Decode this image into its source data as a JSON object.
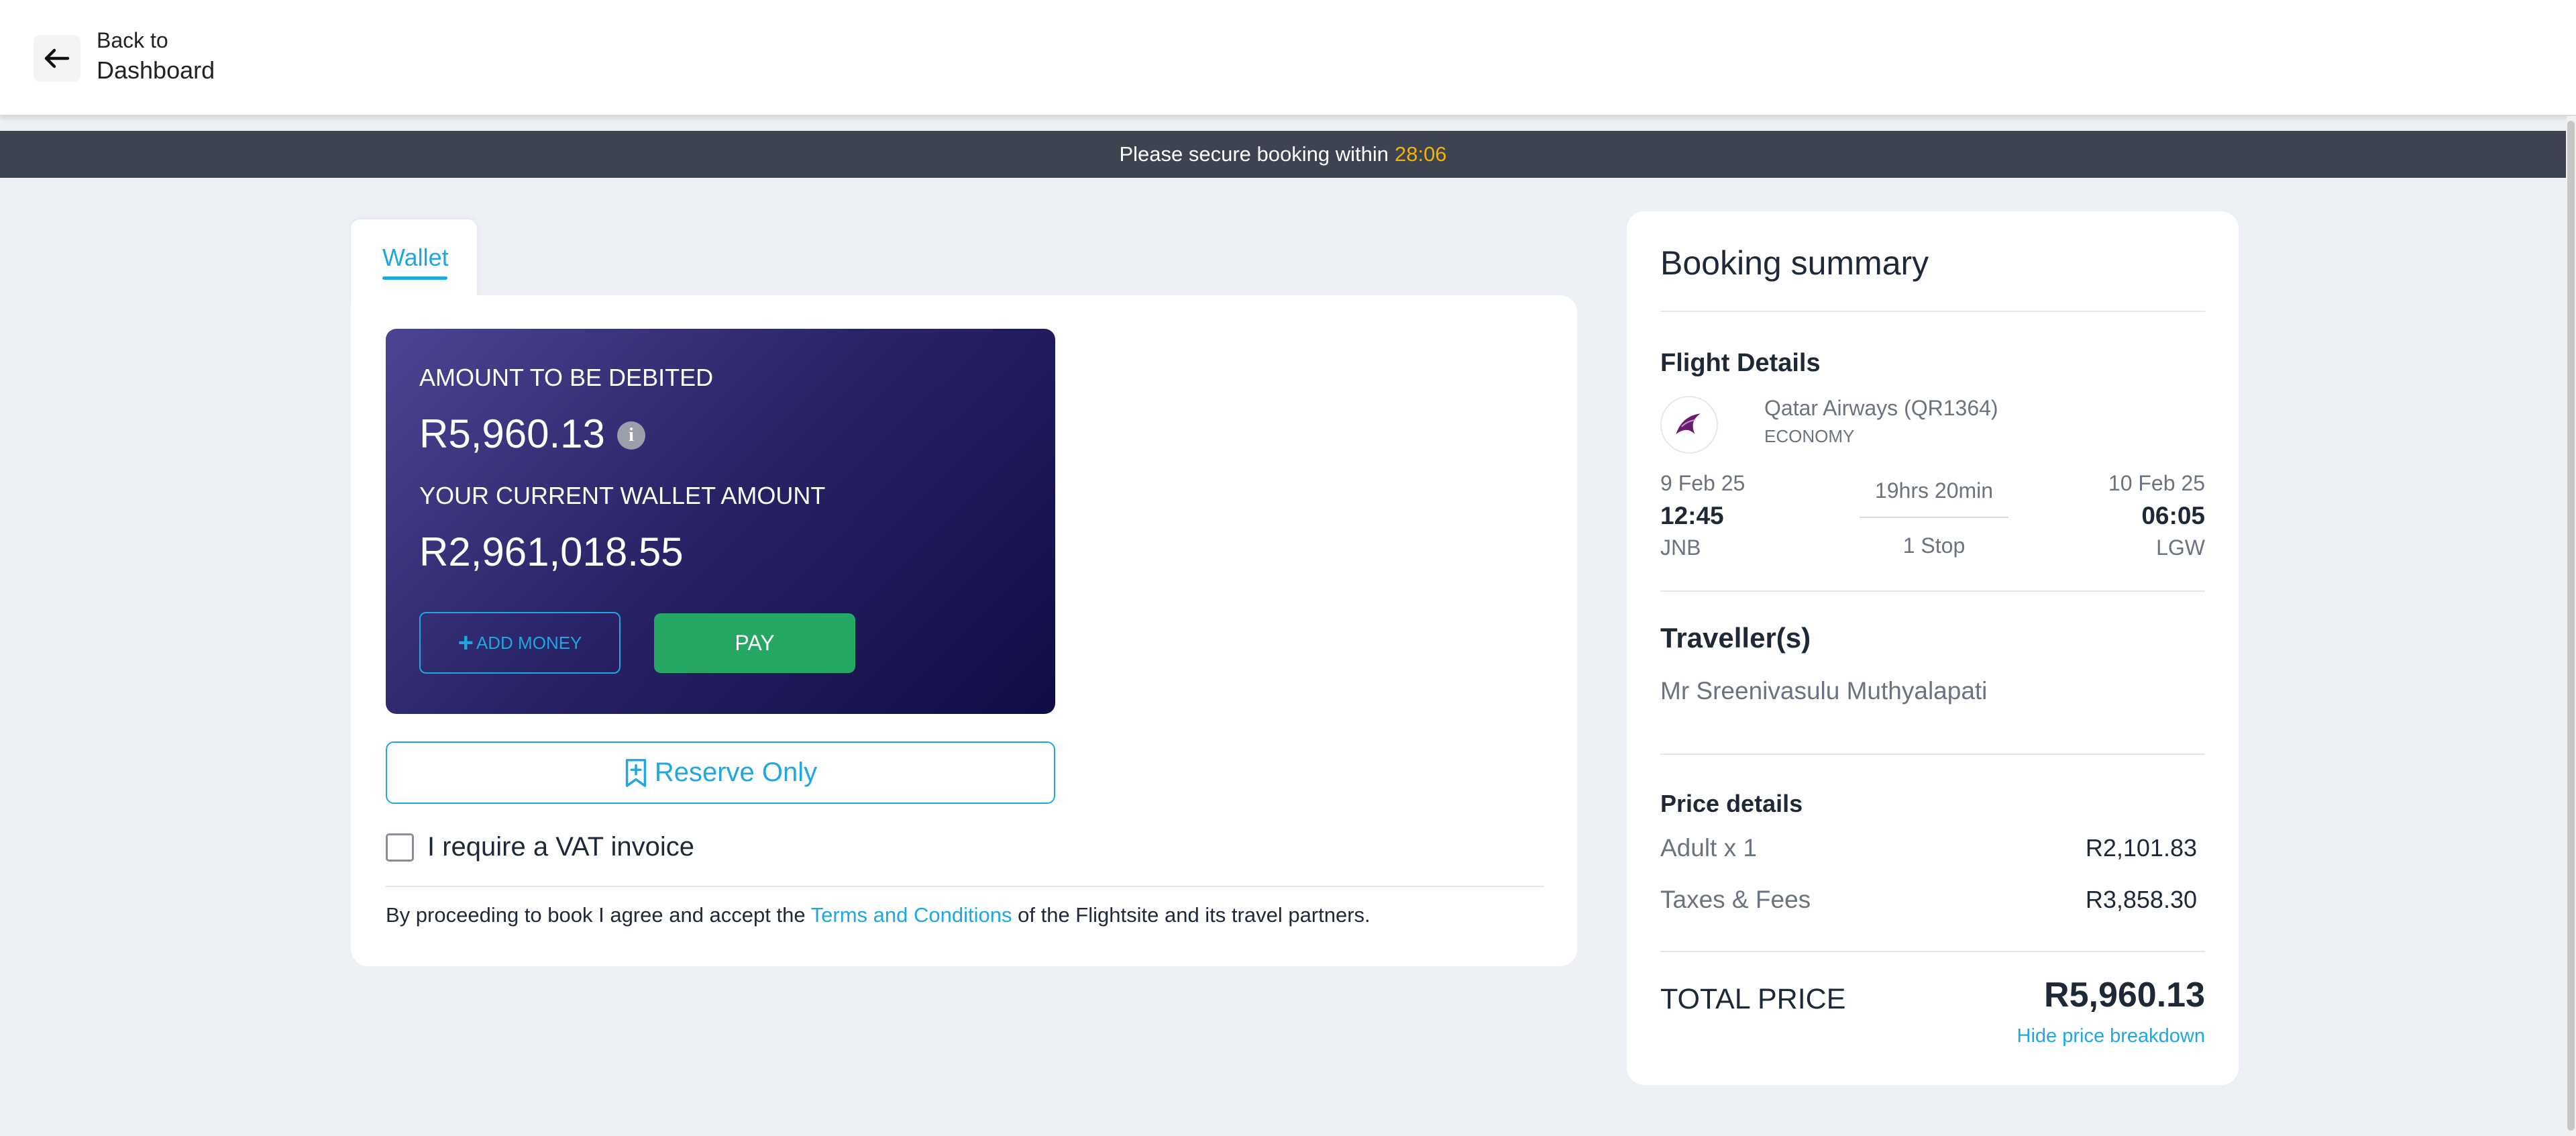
{
  "header": {
    "back_small": "Back to",
    "back_large": "Dashboard"
  },
  "timer": {
    "message": "Please secure booking within",
    "countdown": "28:06"
  },
  "payment": {
    "tab_label": "Wallet",
    "amount_label": "AMOUNT TO BE DEBITED",
    "amount_value": "R5,960.13",
    "info_icon_glyph": "i",
    "wallet_label": "YOUR CURRENT WALLET AMOUNT",
    "wallet_value": "R2,961,018.55",
    "add_money_label": "ADD MONEY",
    "pay_label": "PAY",
    "reserve_label": "Reserve Only",
    "vat_label": "I require a VAT invoice",
    "terms_prefix": "By proceeding to book I agree and accept the",
    "terms_link": "Terms and Conditions",
    "terms_suffix": "of the Flightsite and its travel partners."
  },
  "summary": {
    "title": "Booking summary",
    "flight_section": "Flight Details",
    "airline": "Qatar Airways (QR1364)",
    "cabin": "ECONOMY",
    "depart_date": "9 Feb 25",
    "depart_time": "12:45",
    "depart_code": "JNB",
    "duration": "19hrs 20min",
    "stops": "1 Stop",
    "arrive_date": "10 Feb 25",
    "arrive_time": "06:05",
    "arrive_code": "LGW",
    "traveller_section": "Traveller(s)",
    "traveller_name": "Mr Sreenivasulu Muthyalapati",
    "price_section": "Price details",
    "price_rows": [
      {
        "label": "Adult x 1",
        "value": "R2,101.83"
      },
      {
        "label": "Taxes & Fees",
        "value": "R3,858.30"
      }
    ],
    "total_label": "TOTAL PRICE",
    "total_value": "R5,960.13",
    "hide_link": "Hide price breakdown"
  },
  "colors": {
    "accent": "#1ea7e0",
    "pay_green": "#24a863",
    "timer_highlight": "#f5b301",
    "timer_bar": "#3d4451"
  },
  "icons": {
    "back": "arrow-left-icon",
    "info": "info-icon",
    "add": "plus-icon",
    "reserve": "bookmark-plus-icon",
    "airline": "qatar-airways-logo"
  }
}
